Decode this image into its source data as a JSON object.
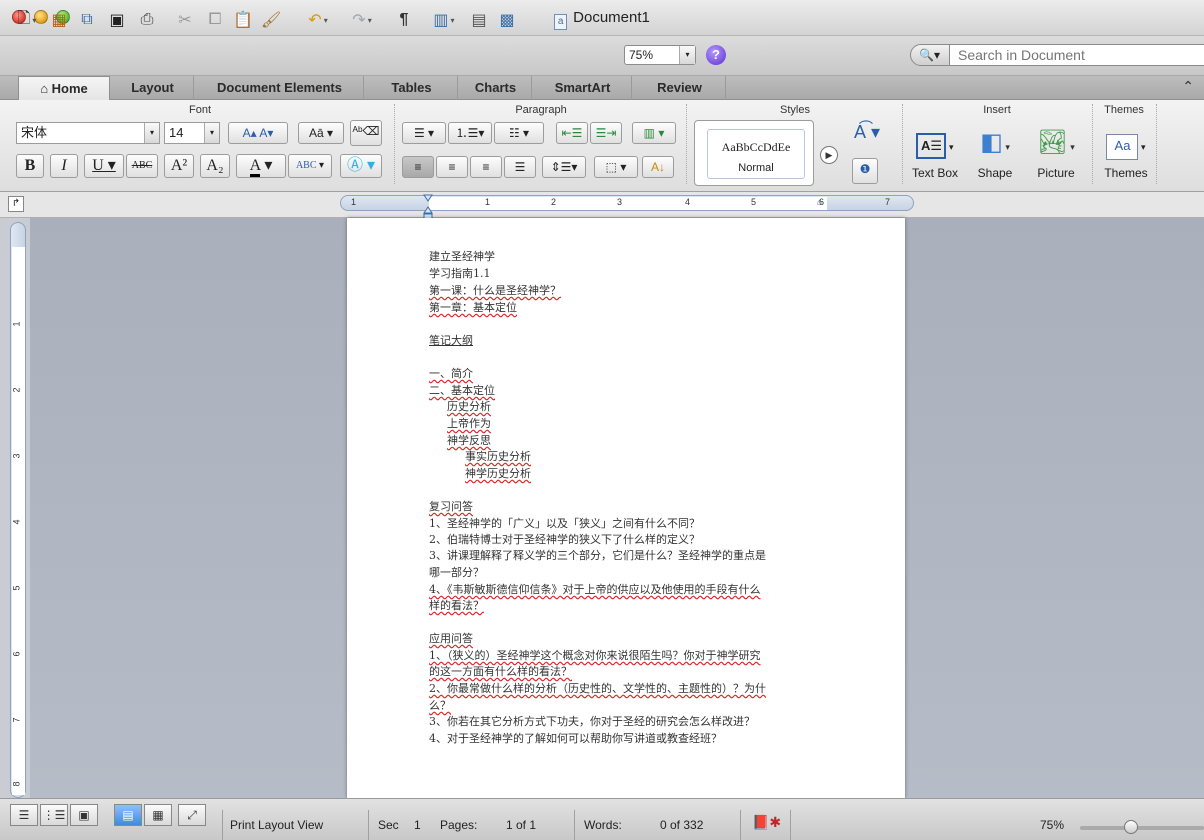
{
  "window": {
    "title": "Document1"
  },
  "toolbar": {
    "zoom_value": "75%",
    "help_label": "?",
    "search_placeholder": "Search in Document",
    "paragraph_mark": "¶"
  },
  "ribbon_tabs": [
    {
      "label": "Home"
    },
    {
      "label": "Layout"
    },
    {
      "label": "Document Elements"
    },
    {
      "label": "Tables"
    },
    {
      "label": "Charts"
    },
    {
      "label": "SmartArt"
    },
    {
      "label": "Review"
    }
  ],
  "groups": {
    "font": "Font",
    "paragraph": "Paragraph",
    "styles": "Styles",
    "insert": "Insert",
    "themes": "Themes"
  },
  "font_controls": {
    "font_name": "宋体",
    "font_size": "14"
  },
  "styles": {
    "sample_text": "AaBbCcDdEe",
    "sample_name": "Normal"
  },
  "insert": {
    "text_box": "Text Box",
    "shape": "Shape",
    "picture": "Picture"
  },
  "themes": {
    "label": "Themes"
  },
  "ruler": {
    "h_numbers": [
      "1",
      "1",
      "2",
      "3",
      "4",
      "5",
      "6",
      "7"
    ],
    "v_numbers": [
      "1",
      "2",
      "3",
      "4",
      "5",
      "6",
      "7",
      "8"
    ]
  },
  "document": {
    "lines": [
      {
        "text": "建立圣经神学"
      },
      {
        "text": "学习指南1.1"
      },
      {
        "text": "第一课：什么是圣经神学？"
      },
      {
        "text": "第一章：基本定位"
      },
      {
        "text": ""
      },
      {
        "text": "笔记大纲"
      },
      {
        "text": ""
      },
      {
        "text": "一、简介"
      },
      {
        "text": "二、基本定位"
      },
      {
        "text": "历史分析"
      },
      {
        "text": "上帝作为"
      },
      {
        "text": "神学反思"
      },
      {
        "text": "事实历史分析"
      },
      {
        "text": "神学历史分析"
      },
      {
        "text": ""
      },
      {
        "text": "复习问答"
      },
      {
        "text": "1、圣经神学的「广义」以及「狭义」之间有什么不同？"
      },
      {
        "text": "2、伯瑞特博士对于圣经神学的狭义下了什么样的定义？"
      },
      {
        "text": "3、讲课理解释了释义学的三个部分，它们是什么？圣经神学的重点是"
      },
      {
        "text": "哪一部分？"
      },
      {
        "text": "4、《韦斯敏斯德信仰信条》对于上帝的供应以及他使用的手段有什么"
      },
      {
        "text": "样的看法？"
      },
      {
        "text": ""
      },
      {
        "text": "应用问答"
      },
      {
        "text": "1、（狭义的）圣经神学这个概念对你来说很陌生吗？你对于神学研究"
      },
      {
        "text": "的这一方面有什么样的看法？"
      },
      {
        "text": "2、你最常做什么样的分析（历史性的、文学性的、主题性的）？为什"
      },
      {
        "text": "么？"
      },
      {
        "text": "3、你若在其它分析方式下功夫，你对于圣经的研究会怎么样改进？"
      },
      {
        "text": "4、对于圣经神学的了解如何可以帮助你写讲道或教查经班？"
      }
    ]
  },
  "status": {
    "view": "Print Layout View",
    "sec_label": "Sec",
    "sec_value": "1",
    "pages_label": "Pages:",
    "pages_value": "1 of 1",
    "words_label": "Words:",
    "words_value": "0 of 332",
    "zoom": "75%"
  }
}
